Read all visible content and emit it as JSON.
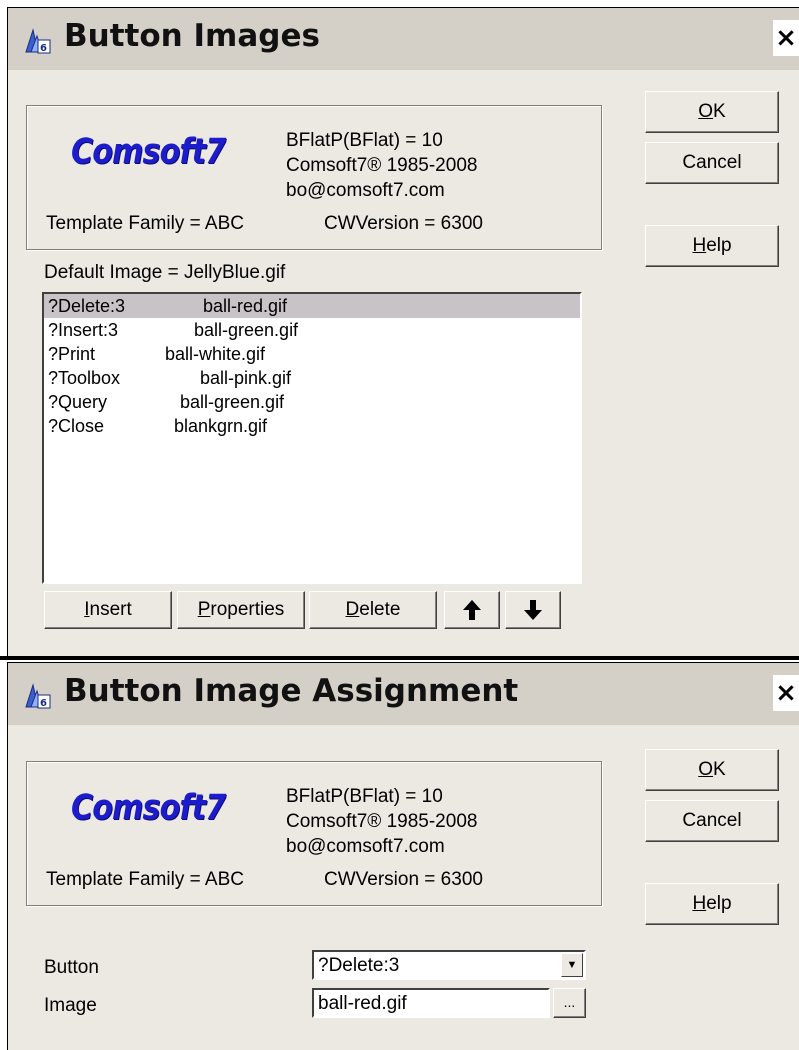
{
  "dialogs": [
    {
      "title": "Button Images",
      "close": "×",
      "logo_text": "Comsoft7",
      "info_lines": [
        "BFlatP(BFlat) = 10",
        "Comsoft7® 1985-2008",
        "bo@comsoft7.com"
      ],
      "template_family": "Template Family = ABC",
      "cw_version": "CWVersion = 6300",
      "buttons": {
        "ok": {
          "pre": "",
          "key": "O",
          "post": "K"
        },
        "cancel": "Cancel",
        "help": {
          "pre": "",
          "key": "H",
          "post": "elp"
        }
      },
      "default_image": "Default Image = JellyBlue.gif",
      "list": [
        {
          "button": "?Delete:3",
          "image": "ball-red.gif",
          "selected": true
        },
        {
          "button": "?Insert:3",
          "image": "ball-green.gif"
        },
        {
          "button": "?Print",
          "image": "ball-white.gif"
        },
        {
          "button": "?Toolbox",
          "image": "ball-pink.gif"
        },
        {
          "button": "?Query",
          "image": "ball-green.gif"
        },
        {
          "button": "?Close",
          "image": "blankgrn.gif"
        }
      ],
      "actions": {
        "insert": {
          "pre": "",
          "key": "I",
          "post": "nsert"
        },
        "properties": {
          "pre": "",
          "key": "P",
          "post": "roperties"
        },
        "delete": {
          "pre": "",
          "key": "D",
          "post": "elete"
        },
        "move_up_icon": "arrow-up-icon",
        "move_down_icon": "arrow-down-icon"
      }
    },
    {
      "title": "Button Image Assignment",
      "close": "×",
      "logo_text": "Comsoft7",
      "info_lines": [
        "BFlatP(BFlat) = 10",
        "Comsoft7® 1985-2008",
        "bo@comsoft7.com"
      ],
      "template_family": "Template Family = ABC",
      "cw_version": "CWVersion = 6300",
      "buttons": {
        "ok": {
          "pre": "",
          "key": "O",
          "post": "K"
        },
        "cancel": "Cancel",
        "help": {
          "pre": "",
          "key": "H",
          "post": "elp"
        }
      },
      "fields": {
        "button_label": "Button",
        "button_value": "?Delete:3",
        "image_label": "Image",
        "image_value": "ball-red.gif",
        "browse_label": "..."
      }
    }
  ],
  "colors": {
    "logo": "#1c1ccc",
    "selection": "#c7c3c7",
    "dialog_bg": "#ece9e3",
    "titlebar": "#d4d0c8"
  }
}
